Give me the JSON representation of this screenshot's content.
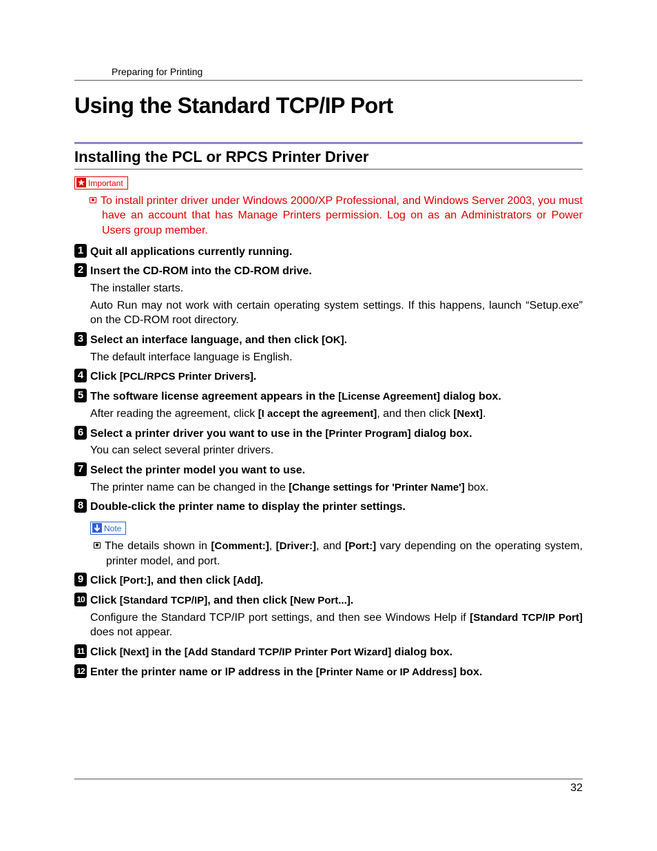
{
  "header": {
    "breadcrumb": "Preparing for Printing"
  },
  "title": "Using the Standard TCP/IP Port",
  "section": "Installing the PCL or RPCS Printer Driver",
  "importantLabel": "Important",
  "importantText": "To install printer driver under Windows 2000/XP Professional, and Windows Server 2003, you must have an account that has Manage Printers permission. Log on as an Administrators or Power Users group member.",
  "noteLabel": "Note",
  "steps": {
    "s1": {
      "num": "1",
      "title": "Quit all applications currently running."
    },
    "s2": {
      "num": "2",
      "title": "Insert the CD-ROM into the CD-ROM drive.",
      "body1": "The installer starts.",
      "body2": "Auto Run may not work with certain operating system settings. If this happens, launch “Setup.exe” on the CD-ROM root directory."
    },
    "s3": {
      "num": "3",
      "t1": "Select an interface language, and then click ",
      "u1": "[OK]",
      "t2": ".",
      "body1": "The default interface language is English."
    },
    "s4": {
      "num": "4",
      "t1": "Click ",
      "u1": "[PCL/RPCS Printer Drivers]",
      "t2": "."
    },
    "s5": {
      "num": "5",
      "t1": "The software license agreement appears in the ",
      "u1": "[License Agreement]",
      "t2": " dialog box.",
      "b1": "After reading the agreement, click ",
      "bu1": "[I accept the agreement]",
      "b2": ", and then click ",
      "bu2": "[Next]",
      "b3": "."
    },
    "s6": {
      "num": "6",
      "t1": "Select a printer driver you want to use in the ",
      "u1": "[Printer Program]",
      "t2": " dialog box.",
      "body1": "You can select several printer drivers."
    },
    "s7": {
      "num": "7",
      "title": "Select the printer model you want to use.",
      "b1": "The printer name can be changed in the ",
      "bu1": "[Change settings for 'Printer Name']",
      "b2": " box."
    },
    "s8": {
      "num": "8",
      "title": "Double-click the printer name to display the printer settings.",
      "n1": "The details shown in ",
      "nu1": "[Comment:]",
      "n2": ", ",
      "nu2": "[Driver:]",
      "n3": ", and ",
      "nu3": "[Port:]",
      "n4": " vary depending on the operating system, printer model, and port."
    },
    "s9": {
      "num": "9",
      "t1": "Click ",
      "u1": "[Port:]",
      "t2": ", and then click ",
      "u2": "[Add]",
      "t3": "."
    },
    "s10": {
      "num": "10",
      "t1": "Click ",
      "u1": "[Standard TCP/IP]",
      "t2": ", and then click ",
      "u2": "[New Port...]",
      "t3": ".",
      "b1": "Configure the Standard TCP/IP port settings, and then see Windows Help if ",
      "bu1": "[Standard TCP/IP Port]",
      "b2": " does not appear."
    },
    "s11": {
      "num": "11",
      "t1": "Click ",
      "u1": "[Next]",
      "t2": " in the ",
      "u2": "[Add Standard TCP/IP Printer Port Wizard]",
      "t3": " dialog box."
    },
    "s12": {
      "num": "12",
      "t1": "Enter the printer name or IP address in the ",
      "u1": "[Printer Name or IP Address]",
      "t2": " box."
    }
  },
  "pageNumber": "32"
}
